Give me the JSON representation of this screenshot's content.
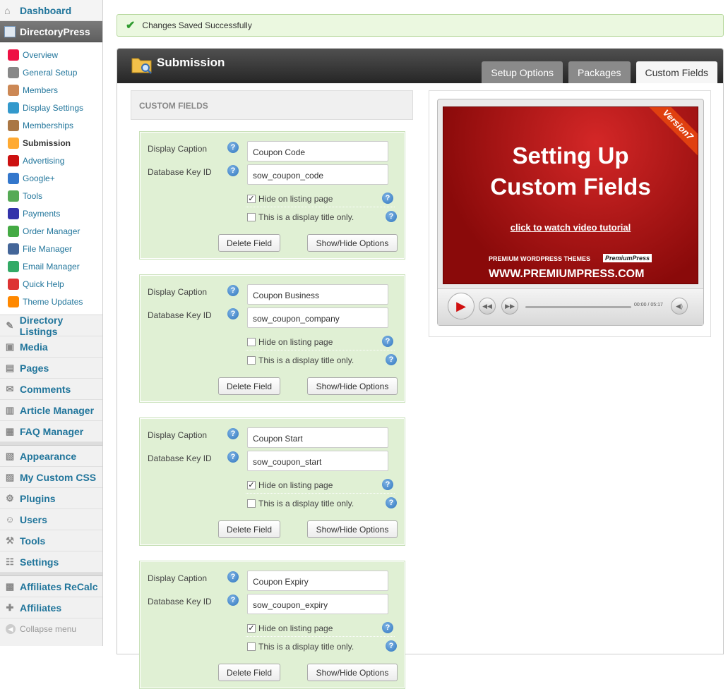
{
  "sidebar": {
    "dashboard": "Dashboard",
    "current": "DirectoryPress",
    "sub_items": [
      {
        "label": "Overview",
        "icon": "chart-icon"
      },
      {
        "label": "General Setup",
        "icon": "tools-icon"
      },
      {
        "label": "Members",
        "icon": "user-icon"
      },
      {
        "label": "Display Settings",
        "icon": "grid-icon"
      },
      {
        "label": "Memberships",
        "icon": "card-icon"
      },
      {
        "label": "Submission",
        "icon": "folder-search-icon"
      },
      {
        "label": "Advertising",
        "icon": "ads-icon"
      },
      {
        "label": "Google+",
        "icon": "google-icon"
      },
      {
        "label": "Tools",
        "icon": "tools-icon"
      },
      {
        "label": "Payments",
        "icon": "payment-icon"
      },
      {
        "label": "Order Manager",
        "icon": "dollar-icon"
      },
      {
        "label": "File Manager",
        "icon": "file-icon"
      },
      {
        "label": "Email Manager",
        "icon": "email-icon"
      },
      {
        "label": "Quick Help",
        "icon": "help-icon"
      },
      {
        "label": "Theme Updates",
        "icon": "rss-icon"
      }
    ],
    "groups_a": [
      "Directory Listings",
      "Media",
      "Pages",
      "Comments",
      "Article Manager",
      "FAQ Manager"
    ],
    "groups_b": [
      "Appearance",
      "My Custom CSS",
      "Plugins",
      "Users",
      "Tools",
      "Settings"
    ],
    "groups_c": [
      "Affiliates ReCalc",
      "Affiliates"
    ],
    "collapse": "Collapse menu"
  },
  "notice": "Changes Saved Successfully",
  "panel": {
    "title": "Submission",
    "tabs": [
      "Setup Options",
      "Packages",
      "Custom Fields"
    ],
    "section_header": "CUSTOM FIELDS"
  },
  "fields": [
    {
      "caption_label": "Display Caption",
      "key_label": "Database Key ID",
      "caption": "Coupon Code",
      "key": "sow_coupon_code",
      "hide_label": "Hide on listing page",
      "hide": true,
      "title_label": "This is a display title only.",
      "title_only": false,
      "delete": "Delete Field",
      "options": "Show/Hide Options"
    },
    {
      "caption_label": "Display Caption",
      "key_label": "Database Key ID",
      "caption": "Coupon Business",
      "key": "sow_coupon_company",
      "hide_label": "Hide on listing page",
      "hide": false,
      "title_label": "This is a display title only.",
      "title_only": false,
      "delete": "Delete Field",
      "options": "Show/Hide Options"
    },
    {
      "caption_label": "Display Caption",
      "key_label": "Database Key ID",
      "caption": "Coupon Start",
      "key": "sow_coupon_start",
      "hide_label": "Hide on listing page",
      "hide": true,
      "title_label": "This is a display title only.",
      "title_only": false,
      "delete": "Delete Field",
      "options": "Show/Hide Options"
    },
    {
      "caption_label": "Display Caption",
      "key_label": "Database Key ID",
      "caption": "Coupon Expiry",
      "key": "sow_coupon_expiry",
      "hide_label": "Hide on listing page",
      "hide": true,
      "title_label": "This is a display title only.",
      "title_only": false,
      "delete": "Delete Field",
      "options": "Show/Hide Options"
    }
  ],
  "video": {
    "badge": "Version7",
    "line1": "Setting Up",
    "line2": "Custom Fields",
    "link": "click to watch video tutorial",
    "tagline": "PREMIUM WORDPRESS THEMES",
    "brand": "PremiumPress",
    "url": "WWW.PREMIUMPRESS.COM",
    "time": "00:00 / 05:17"
  }
}
